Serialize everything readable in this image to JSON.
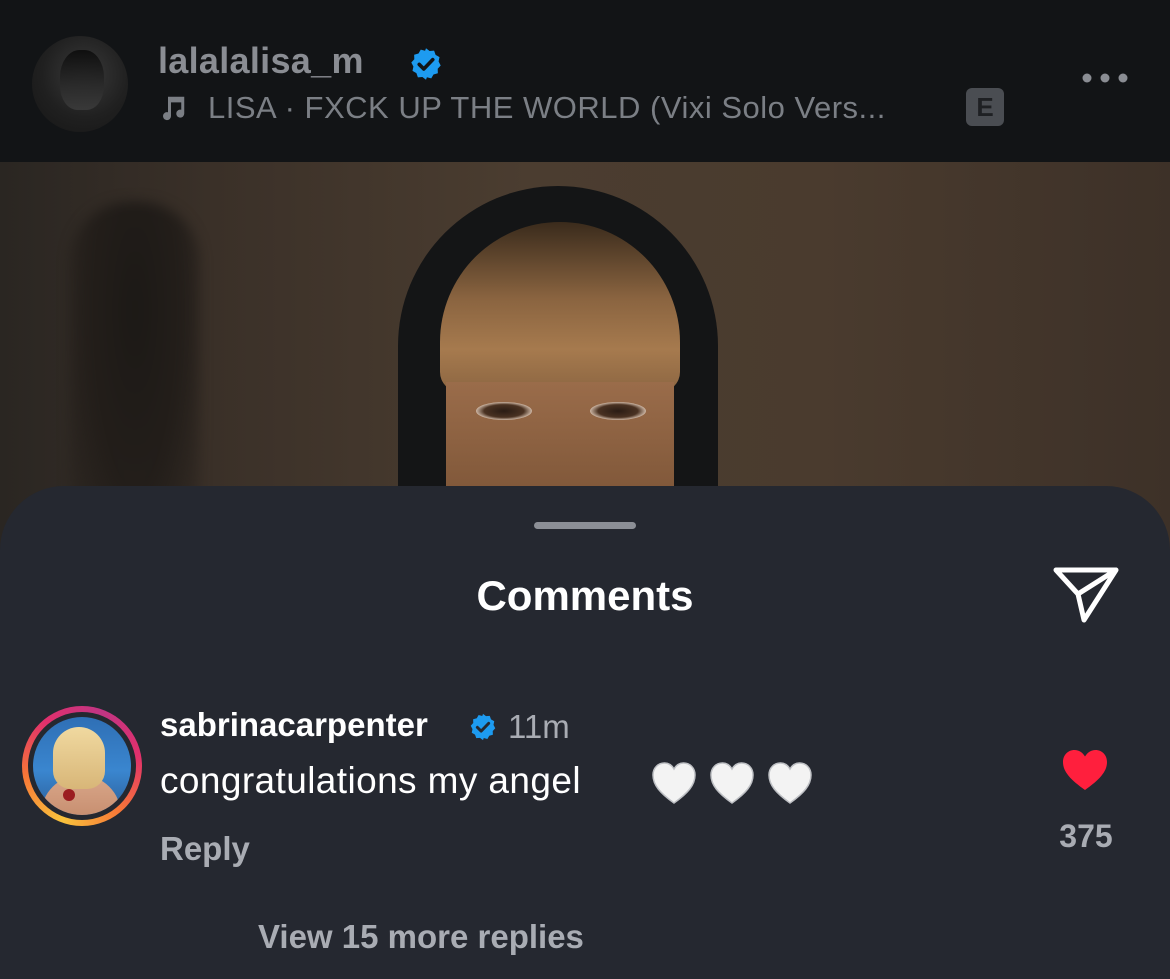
{
  "post_header": {
    "username": "lalalalisa_m",
    "verified": true,
    "song": "LISA · FXCK UP THE WORLD (Vixi Solo Vers...",
    "explicit_badge": "E",
    "more_icon": "more-horizontal-icon",
    "music_icon": "music-note-icon"
  },
  "comments_sheet": {
    "title": "Comments",
    "share_icon": "send-icon"
  },
  "comment": {
    "username": "sabrinacarpenter",
    "verified": true,
    "time": "11m",
    "text": "congratulations my angel",
    "emoji": [
      "white-heart",
      "white-heart",
      "white-heart"
    ],
    "reply_label": "Reply",
    "like_count": "375",
    "liked": true,
    "view_replies_label": "View 15 more replies"
  },
  "colors": {
    "header_bg": "#121416",
    "sheet_bg": "#252830",
    "verified_blue": "#1d9bf0",
    "like_red": "#ff1f3d",
    "muted_text": "#a9acb3"
  }
}
